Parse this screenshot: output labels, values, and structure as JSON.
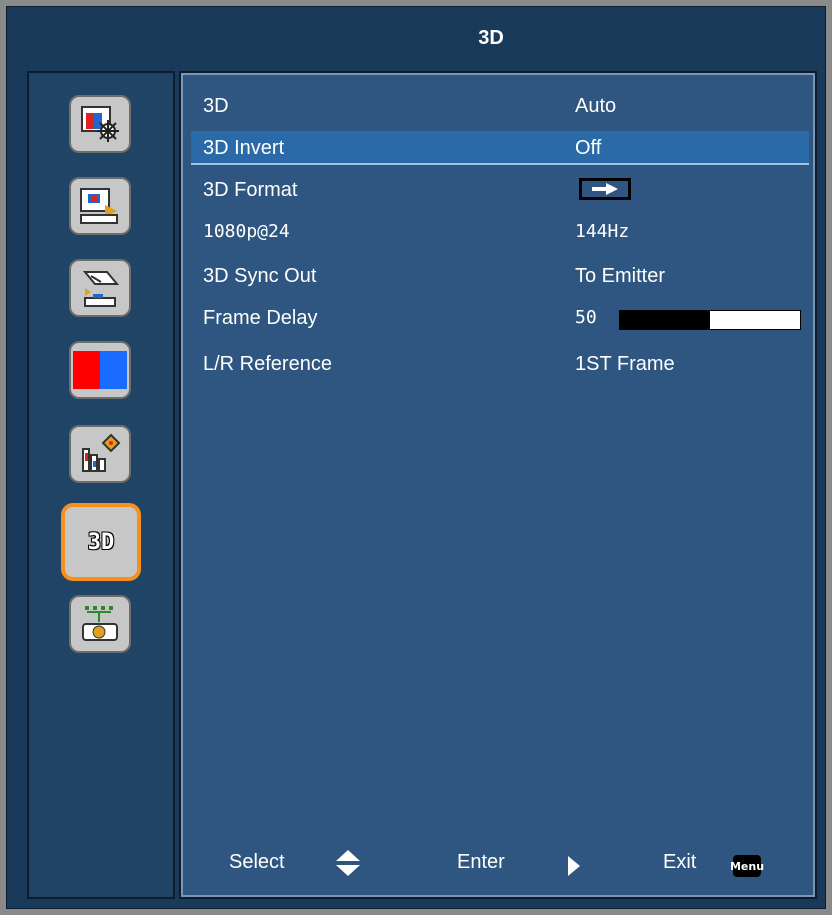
{
  "window": {
    "title": "3D"
  },
  "sidebar": {
    "items": [
      {
        "icon": "image-settings-icon",
        "active": false
      },
      {
        "icon": "display-settings-icon",
        "active": false
      },
      {
        "icon": "setup-icon",
        "active": false
      },
      {
        "icon": "color-icon",
        "active": false
      },
      {
        "icon": "info-icon",
        "active": false
      },
      {
        "icon": "3d-icon",
        "label": "3D",
        "active": true
      },
      {
        "icon": "network-icon",
        "active": false
      }
    ]
  },
  "menu": {
    "rows": [
      {
        "label": "3D",
        "value": "Auto"
      },
      {
        "label": "3D Invert",
        "value": "Off",
        "selected": true
      },
      {
        "label": "3D Format",
        "value_icon": "right-arrow-icon"
      },
      {
        "label": "1080p@24",
        "value": "144Hz"
      },
      {
        "label": "3D Sync Out",
        "value": "To Emitter"
      },
      {
        "label": "Frame Delay",
        "value": "50",
        "slider_fraction": 0.5
      },
      {
        "label": "L/R Reference",
        "value": "1ST Frame"
      }
    ]
  },
  "footer": {
    "select_label": "Select",
    "enter_label": "Enter",
    "exit_label": "Exit",
    "menu_key": "Menu"
  },
  "colors": {
    "background": "#1a3a5a",
    "panel": "#2e5680",
    "highlight": "#2a6aa8",
    "active_border": "#f5901e"
  }
}
